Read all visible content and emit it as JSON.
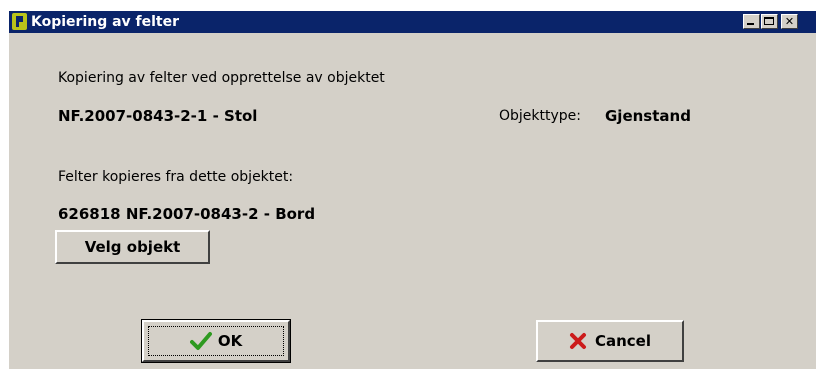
{
  "window": {
    "title": "Kopiering av felter"
  },
  "dialog": {
    "intro": "Kopiering av felter ved opprettelse av objektet",
    "object_id": "NF.2007-0843-2-1 - Stol",
    "type_label": "Objekttype:",
    "type_value": "Gjenstand",
    "source_label": "Felter kopieres fra dette objektet:",
    "source_object": "626818 NF.2007-0843-2 - Bord",
    "select_button": "Velg objekt",
    "ok_button": "OK",
    "cancel_button": "Cancel"
  },
  "colors": {
    "titlebar": "#0a246a",
    "face": "#d4d0c8",
    "ok_check": "#2e9a20",
    "cancel_x": "#cc1b1b"
  }
}
